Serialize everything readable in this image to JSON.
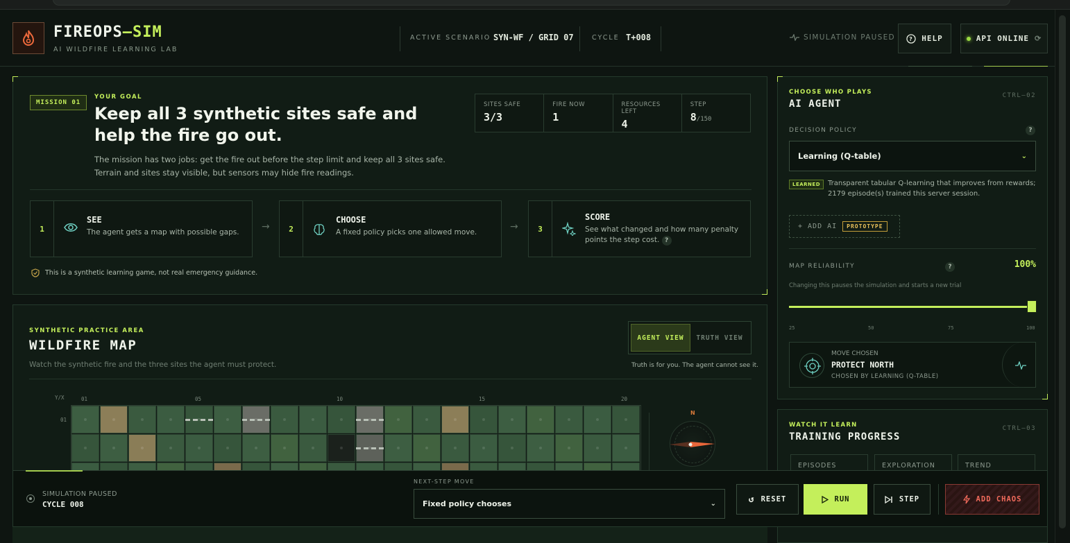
{
  "header": {
    "brand_main": "FIREOPS",
    "brand_dash": "—SIM",
    "brand_sub": "AI WILDFIRE LEARNING LAB",
    "scenario_label": "ACTIVE SCENARIO",
    "scenario_value": "SYN-WF / GRID 07",
    "cycle_label": "CYCLE",
    "cycle_value": "T+008",
    "sim_status": "SIMULATION PAUSED",
    "help_label": "HELP",
    "api_label": "API ONLINE"
  },
  "mission": {
    "badge": "MISSION 01",
    "goal_label": "YOUR GOAL",
    "title": "Keep all 3 synthetic sites safe and help the fire go out.",
    "description": "The mission has two jobs: get the fire out before the step limit and keep all 3 sites safe. Terrain and sites stay visible, but sensors may hide fire readings.",
    "stats": [
      {
        "label": "SITES SAFE",
        "value": "3/3",
        "suffix": ""
      },
      {
        "label": "FIRE NOW",
        "value": "1",
        "suffix": ""
      },
      {
        "label": "RESOURCES LEFT",
        "value": "4",
        "suffix": ""
      },
      {
        "label": "STEP",
        "value": "8",
        "suffix": "/150"
      }
    ],
    "steps": [
      {
        "num": "1",
        "title": "SEE",
        "desc": "The agent gets a map with possible gaps.",
        "icon": "eye-icon"
      },
      {
        "num": "2",
        "title": "CHOOSE",
        "desc": "A fixed policy picks one allowed move.",
        "icon": "brain-icon"
      },
      {
        "num": "3",
        "title": "SCORE",
        "desc": "See what changed and how many penalty points the step cost.",
        "icon": "sparkle-icon"
      }
    ],
    "disclaimer": "This is a synthetic learning game, not real emergency guidance."
  },
  "map": {
    "label": "SYNTHETIC PRACTICE AREA",
    "title": "WILDFIRE MAP",
    "desc": "Watch the synthetic fire and the three sites the agent must protect.",
    "agent_view": "AGENT VIEW",
    "truth_view": "TRUTH VIEW",
    "truth_note": "Truth is for you. The agent cannot see it.",
    "axis_corner": "Y/X",
    "x_ticks": [
      "01",
      "05",
      "10",
      "15",
      "20"
    ],
    "y_ticks": [
      "01"
    ],
    "compass_n": "N"
  },
  "agent": {
    "label": "CHOOSE WHO PLAYS",
    "title": "AI AGENT",
    "ctrl": "CTRL—02",
    "policy_label": "DECISION POLICY",
    "policy_value": "Learning (Q-table)",
    "learned_tag": "LEARNED",
    "learned_desc": "Transparent tabular Q-learning that improves from rewards; 2179 episode(s) trained this server session.",
    "add_ai": "+ ADD AI",
    "prototype": "PROTOTYPE",
    "reliability_label": "MAP RELIABILITY",
    "reliability_value": "100%",
    "reliability_fraction": 1.0,
    "reliability_note": "Changing this pauses the simulation and starts a new trial",
    "ticks": [
      "25",
      "50",
      "75",
      "100"
    ],
    "move_label": "MOVE CHOSEN",
    "move_value": "PROTECT NORTH",
    "move_source": "CHOSEN BY LEARNING (Q-TABLE)"
  },
  "training": {
    "label": "WATCH IT LEARN",
    "title": "TRAINING PROGRESS",
    "ctrl": "CTRL—03",
    "boxes": [
      "EPISODES",
      "EXPLORATION",
      "TREND"
    ]
  },
  "bottom": {
    "status": "SIMULATION PAUSED",
    "cycle": "CYCLE 008",
    "next_label": "NEXT-STEP MOVE",
    "next_value": "Fixed policy chooses",
    "reset": "RESET",
    "run": "RUN",
    "step": "STEP",
    "chaos": "ADD CHAOS"
  },
  "colors": {
    "accent": "#c4ef5b",
    "danger": "#f06a5b",
    "warn": "#e8c05a",
    "background": "#0e1511"
  }
}
